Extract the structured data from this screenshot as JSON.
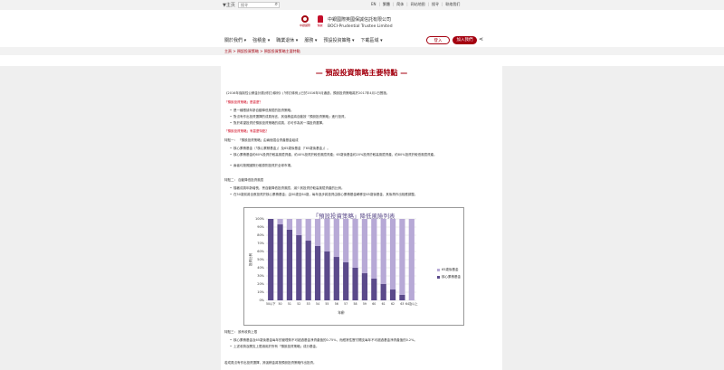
{
  "topbar": {
    "lang": "▼主页",
    "search_placeholder": "搜寻",
    "links": [
      "EN",
      "繁體",
      "简体",
      "网站地图",
      "搜寻",
      "联络我们"
    ]
  },
  "header": {
    "logo1_text": "中銀國際",
    "logo2_text": "保誠",
    "brand_zh": "中銀國際英國保誠信託有限公司",
    "brand_en": "BOCI-Prudential Trustee Limited"
  },
  "nav": {
    "items": [
      "關於我們 ▾",
      "強積金 ▾",
      "職業退休 ▾",
      "服務 ▾",
      "預設投資策略 ▾",
      "下載區域 ▾"
    ]
  },
  "buttons": {
    "login": "登入",
    "join": "加入我們"
  },
  "breadcrumb": {
    "text": "主頁 > 預設投資策略 > 預設投資策略主要特點"
  },
  "page": {
    "title": "— 預設投資策略主要特點 —",
    "intro": "《2016年強制性公積金計劃(修訂)條例》(「修訂條例」)已於2016年5月通過，預設投資策略將於2017年4月1日實施。",
    "what_heading": "「預設投資策略」是甚麼？",
    "what_bullets": [
      "是一種根據年齡自動降低風險的投資策略。",
      "對沒有作出投資選擇的成員而言，其強積金將自動按「預設投資策略」進行投資。",
      "對於希望投資於預設投資策略的成員，亦可作為其一項投資選擇。"
    ],
    "features_heading": "「預設投資策略」有甚麼特點？",
    "feature1_label": "特點一：",
    "feature1_text": "「預設投資策略」由兩個混合資產基金組成",
    "feature1_bullets": [
      "核心累積基金（「核心累積基金」）及65歲後基金（「65歲後基金」）。",
      "核心累積基金約60%投資於較高風險資產，約40%投資於較低風險資產；65歲後基金約20%投資於較高風險資產，約80%投資於較低風險資產。",
      "兩者均按照國際分散原則投資於全球市場。"
    ],
    "feature2_label": "特點二：",
    "feature2_text": "自動降低投資風險",
    "feature2_bullets": [
      "隨著成員年齡增長，會自動降低投資風險，減少其投資於較高風險資產的比例。",
      "在50歲前將全數投資於核心累積基金；由50歲至64歲，每年逐步將投資由核心累積基金轉移至65歲後基金，其後再作出相應調整。"
    ],
    "feature3_label": "特點三：",
    "feature3_text": "設有收費上限",
    "feature3_bullets": [
      "核心累積基金及65歲後基金每年的管理費不可超過基金淨資產值的0.75%，而經常性實付開支每年不可超過基金淨資產值的0.2%。",
      "上述收費及開支上限適用於所有「預設投資策略」成分基金。"
    ],
    "footer_text": "若成員沒有作出投資選擇，其強積金將按預設投資策略作出投資。"
  },
  "chart_data": {
    "type": "bar",
    "title": "「預設投資策略」降低風險列表",
    "ylabel": "投資比例",
    "xlabel": "年齡",
    "categories": [
      "50以下",
      "50",
      "51",
      "52",
      "53",
      "54",
      "55",
      "56",
      "57",
      "58",
      "59",
      "60",
      "61",
      "62",
      "63",
      "64及以上"
    ],
    "ylim": [
      0,
      100
    ],
    "yticks": [
      "0%",
      "10%",
      "20%",
      "30%",
      "40%",
      "50%",
      "60%",
      "70%",
      "80%",
      "90%",
      "100%"
    ],
    "series": [
      {
        "name": "核心累積基金",
        "values": [
          100,
          93.3,
          86.7,
          80,
          73.3,
          66.7,
          60,
          53.3,
          46.7,
          40,
          33.3,
          26.7,
          20,
          13.3,
          6.7,
          0
        ],
        "color": "#5b4a8b"
      },
      {
        "name": "65歲後基金",
        "values": [
          0,
          6.7,
          13.3,
          20,
          26.7,
          33.3,
          40,
          46.7,
          53.3,
          60,
          66.7,
          73.3,
          80,
          86.7,
          93.3,
          100
        ],
        "color": "#b7a9d6"
      }
    ],
    "grid": true,
    "legend": "right"
  }
}
